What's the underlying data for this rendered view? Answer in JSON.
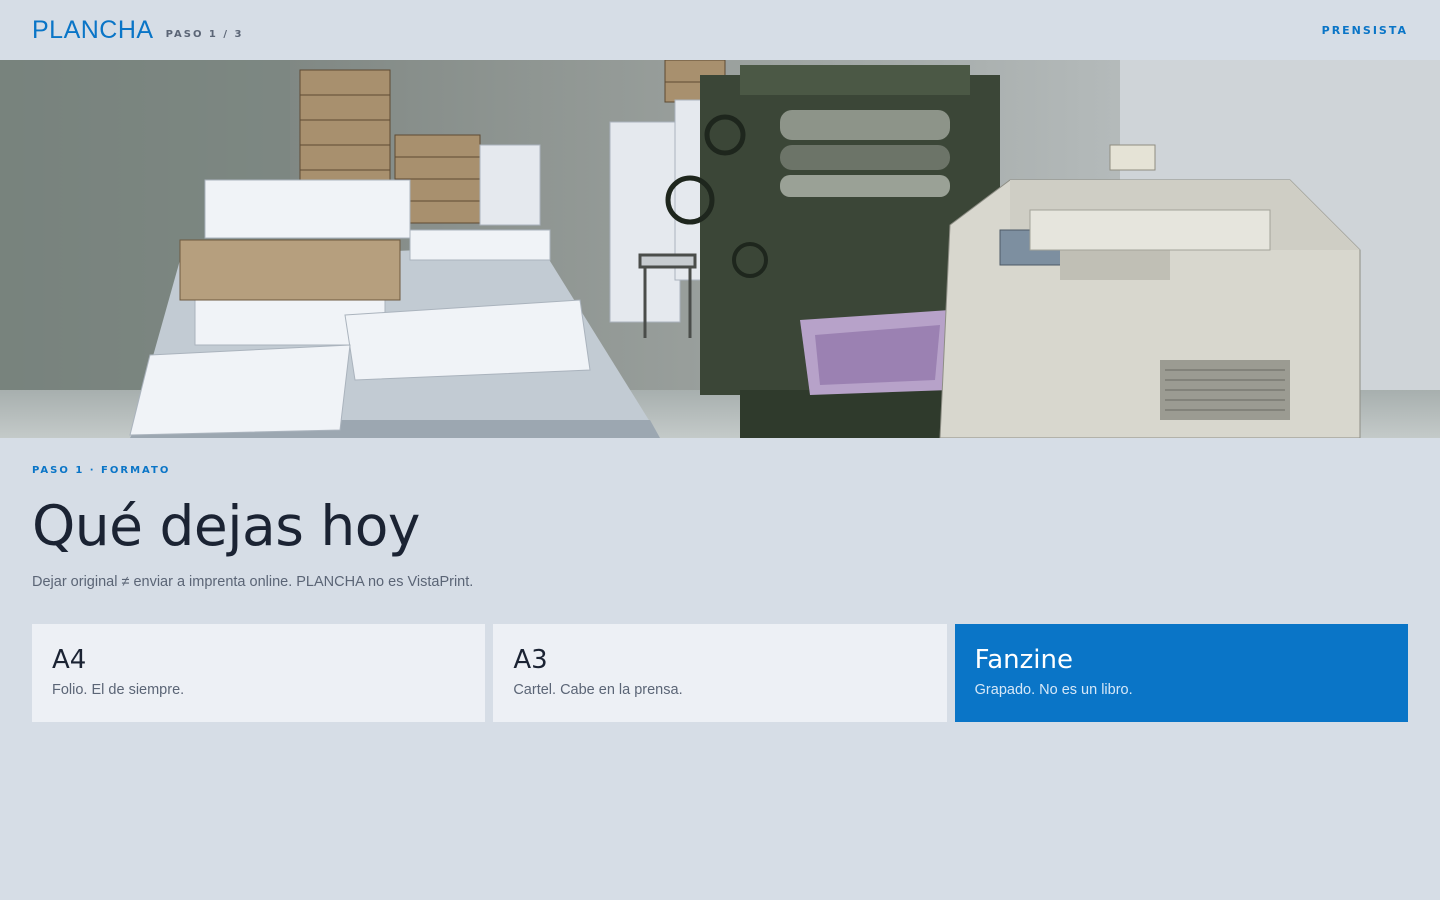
{
  "header": {
    "brand": "PLANCHA",
    "step": "PASO 1 / 3",
    "user": "PRENSISTA"
  },
  "hero": {
    "image": "print-shop-photo"
  },
  "main": {
    "eyebrow": "PASO 1 · FORMATO",
    "title": "Qué dejas hoy",
    "subtitle": "Dejar original ≠ enviar a imprenta online. PLANCHA no es VistaPrint."
  },
  "options": [
    {
      "name": "A4",
      "description": "Folio. El de siempre.",
      "selected": false
    },
    {
      "name": "A3",
      "description": "Cartel. Cabe en la prensa.",
      "selected": false
    },
    {
      "name": "Fanzine",
      "description": "Grapado. No es un libro.",
      "selected": true
    }
  ],
  "colors": {
    "accent": "#0a75c7",
    "background": "#d6dde6",
    "card": "#edf0f5"
  }
}
